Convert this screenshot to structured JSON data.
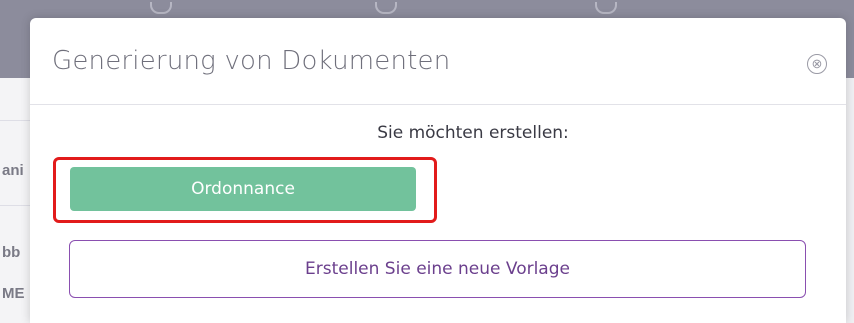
{
  "background": {
    "row_texts": [
      "ani",
      "bb",
      "ME"
    ]
  },
  "modal": {
    "title": "Generierung von Dokumenten",
    "close_icon": "⊗",
    "prompt": "Sie möchten erstellen:",
    "buttons": {
      "ordonnance": "Ordonnance",
      "new_template": "Erstellen Sie eine neue Vorlage"
    }
  },
  "colors": {
    "primary_green": "#72c29c",
    "template_border": "#8a4fb0",
    "highlight_red": "#e21b1b"
  }
}
